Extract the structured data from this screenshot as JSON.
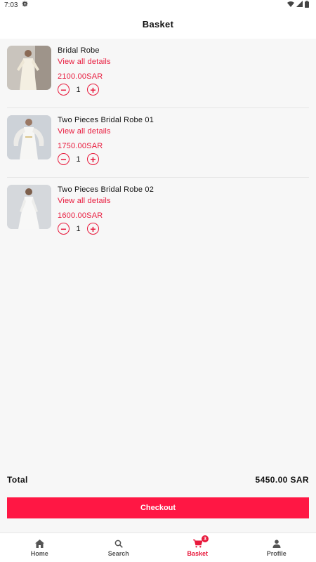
{
  "status_bar": {
    "time": "7:03",
    "icons": [
      "gear-icon",
      "wifi-icon",
      "signal-icon",
      "battery-icon"
    ]
  },
  "header": {
    "title": "Basket"
  },
  "basket": {
    "items": [
      {
        "name": "Bridal Robe",
        "details_link": "View all details",
        "price": "2100.00SAR",
        "quantity": "1"
      },
      {
        "name": "Two Pieces Bridal Robe  01",
        "details_link": "View all details",
        "price": "1750.00SAR",
        "quantity": "1"
      },
      {
        "name": "Two Pieces Bridal Robe  02",
        "details_link": "View all details",
        "price": "1600.00SAR",
        "quantity": "1"
      }
    ]
  },
  "summary": {
    "total_label": "Total",
    "total_value": "5450.00 SAR"
  },
  "checkout": {
    "label": "Checkout"
  },
  "bottom_nav": {
    "items": [
      {
        "label": "Home",
        "icon": "home-icon"
      },
      {
        "label": "Search",
        "icon": "search-icon"
      },
      {
        "label": "Basket",
        "icon": "cart-icon",
        "badge": "3",
        "active": true
      },
      {
        "label": "Profile",
        "icon": "person-icon"
      }
    ]
  },
  "colors": {
    "accent": "#e8193c",
    "checkout_button": "#ff1744",
    "background": "#f7f7f7"
  }
}
